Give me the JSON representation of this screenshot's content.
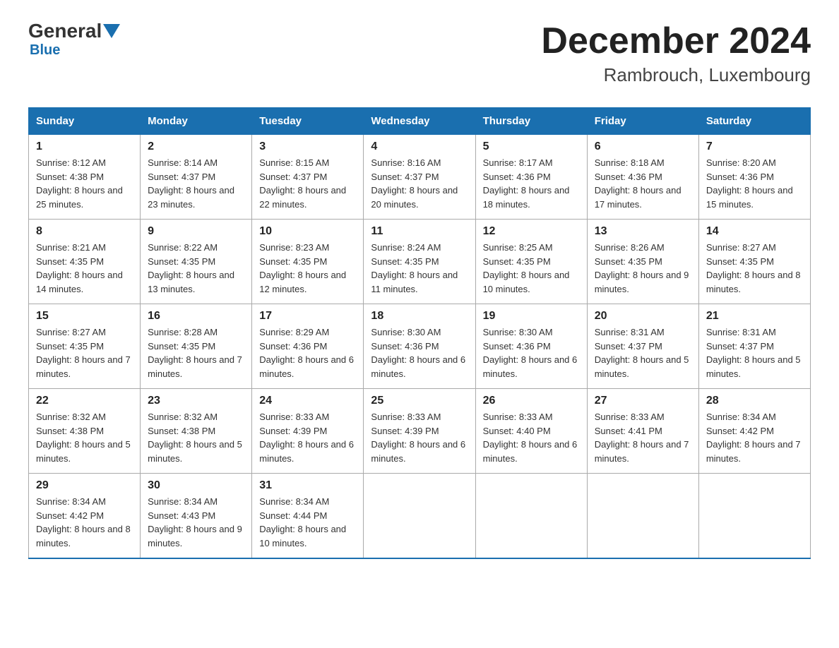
{
  "logo": {
    "general": "General",
    "blue": "Blue",
    "subtitle": "Blue"
  },
  "header": {
    "title": "December 2024",
    "location": "Rambrouch, Luxembourg"
  },
  "days_of_week": [
    "Sunday",
    "Monday",
    "Tuesday",
    "Wednesday",
    "Thursday",
    "Friday",
    "Saturday"
  ],
  "weeks": [
    [
      {
        "day": "1",
        "sunrise": "8:12 AM",
        "sunset": "4:38 PM",
        "daylight": "8 hours and 25 minutes."
      },
      {
        "day": "2",
        "sunrise": "8:14 AM",
        "sunset": "4:37 PM",
        "daylight": "8 hours and 23 minutes."
      },
      {
        "day": "3",
        "sunrise": "8:15 AM",
        "sunset": "4:37 PM",
        "daylight": "8 hours and 22 minutes."
      },
      {
        "day": "4",
        "sunrise": "8:16 AM",
        "sunset": "4:37 PM",
        "daylight": "8 hours and 20 minutes."
      },
      {
        "day": "5",
        "sunrise": "8:17 AM",
        "sunset": "4:36 PM",
        "daylight": "8 hours and 18 minutes."
      },
      {
        "day": "6",
        "sunrise": "8:18 AM",
        "sunset": "4:36 PM",
        "daylight": "8 hours and 17 minutes."
      },
      {
        "day": "7",
        "sunrise": "8:20 AM",
        "sunset": "4:36 PM",
        "daylight": "8 hours and 15 minutes."
      }
    ],
    [
      {
        "day": "8",
        "sunrise": "8:21 AM",
        "sunset": "4:35 PM",
        "daylight": "8 hours and 14 minutes."
      },
      {
        "day": "9",
        "sunrise": "8:22 AM",
        "sunset": "4:35 PM",
        "daylight": "8 hours and 13 minutes."
      },
      {
        "day": "10",
        "sunrise": "8:23 AM",
        "sunset": "4:35 PM",
        "daylight": "8 hours and 12 minutes."
      },
      {
        "day": "11",
        "sunrise": "8:24 AM",
        "sunset": "4:35 PM",
        "daylight": "8 hours and 11 minutes."
      },
      {
        "day": "12",
        "sunrise": "8:25 AM",
        "sunset": "4:35 PM",
        "daylight": "8 hours and 10 minutes."
      },
      {
        "day": "13",
        "sunrise": "8:26 AM",
        "sunset": "4:35 PM",
        "daylight": "8 hours and 9 minutes."
      },
      {
        "day": "14",
        "sunrise": "8:27 AM",
        "sunset": "4:35 PM",
        "daylight": "8 hours and 8 minutes."
      }
    ],
    [
      {
        "day": "15",
        "sunrise": "8:27 AM",
        "sunset": "4:35 PM",
        "daylight": "8 hours and 7 minutes."
      },
      {
        "day": "16",
        "sunrise": "8:28 AM",
        "sunset": "4:35 PM",
        "daylight": "8 hours and 7 minutes."
      },
      {
        "day": "17",
        "sunrise": "8:29 AM",
        "sunset": "4:36 PM",
        "daylight": "8 hours and 6 minutes."
      },
      {
        "day": "18",
        "sunrise": "8:30 AM",
        "sunset": "4:36 PM",
        "daylight": "8 hours and 6 minutes."
      },
      {
        "day": "19",
        "sunrise": "8:30 AM",
        "sunset": "4:36 PM",
        "daylight": "8 hours and 6 minutes."
      },
      {
        "day": "20",
        "sunrise": "8:31 AM",
        "sunset": "4:37 PM",
        "daylight": "8 hours and 5 minutes."
      },
      {
        "day": "21",
        "sunrise": "8:31 AM",
        "sunset": "4:37 PM",
        "daylight": "8 hours and 5 minutes."
      }
    ],
    [
      {
        "day": "22",
        "sunrise": "8:32 AM",
        "sunset": "4:38 PM",
        "daylight": "8 hours and 5 minutes."
      },
      {
        "day": "23",
        "sunrise": "8:32 AM",
        "sunset": "4:38 PM",
        "daylight": "8 hours and 5 minutes."
      },
      {
        "day": "24",
        "sunrise": "8:33 AM",
        "sunset": "4:39 PM",
        "daylight": "8 hours and 6 minutes."
      },
      {
        "day": "25",
        "sunrise": "8:33 AM",
        "sunset": "4:39 PM",
        "daylight": "8 hours and 6 minutes."
      },
      {
        "day": "26",
        "sunrise": "8:33 AM",
        "sunset": "4:40 PM",
        "daylight": "8 hours and 6 minutes."
      },
      {
        "day": "27",
        "sunrise": "8:33 AM",
        "sunset": "4:41 PM",
        "daylight": "8 hours and 7 minutes."
      },
      {
        "day": "28",
        "sunrise": "8:34 AM",
        "sunset": "4:42 PM",
        "daylight": "8 hours and 7 minutes."
      }
    ],
    [
      {
        "day": "29",
        "sunrise": "8:34 AM",
        "sunset": "4:42 PM",
        "daylight": "8 hours and 8 minutes."
      },
      {
        "day": "30",
        "sunrise": "8:34 AM",
        "sunset": "4:43 PM",
        "daylight": "8 hours and 9 minutes."
      },
      {
        "day": "31",
        "sunrise": "8:34 AM",
        "sunset": "4:44 PM",
        "daylight": "8 hours and 10 minutes."
      },
      null,
      null,
      null,
      null
    ]
  ]
}
